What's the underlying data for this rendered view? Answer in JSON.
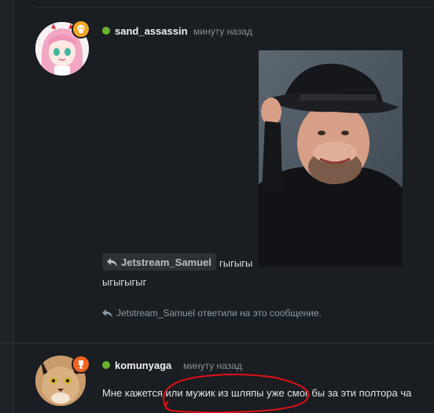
{
  "messages": [
    {
      "username": "sand_assassin",
      "timestamp": "минуту назад",
      "reply_to": "Jetstream_Samuel",
      "reply_text": "гыгыгы",
      "text_line_2": "ыгыгыгыг",
      "replied_note": "Jetstream_Samuel ответили на это сообщение.",
      "badge_icon": "skull-icon",
      "badge_color": "#f6a623"
    },
    {
      "username": "komunyaga",
      "timestamp": "минуту назад",
      "text": "Мне кажется или мужик из шляпы уже смог бы за эти полтора ча",
      "badge_icon": "trophy-icon",
      "badge_color": "#f0641e"
    }
  ],
  "colors": {
    "background": "#1a1d21",
    "online": "#6ab42b",
    "annotation": "#e0101a"
  }
}
